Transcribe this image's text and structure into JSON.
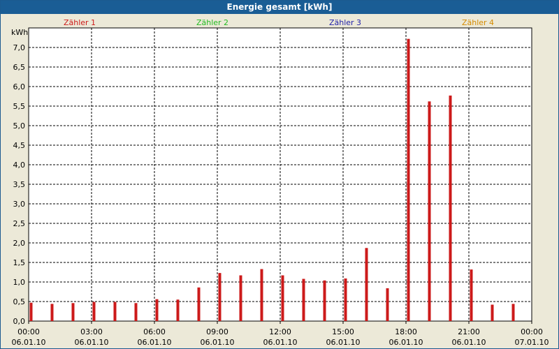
{
  "window": {
    "title": "Energie gesamt [kWh]"
  },
  "colors": {
    "bar": "#cc1a1a",
    "title_bg": "#1a5d95"
  },
  "chart_data": {
    "type": "bar",
    "title": "Energie gesamt [kWh]",
    "ylabel": "kWh",
    "ylim": [
      0,
      7.5
    ],
    "grid": true,
    "legend": [
      {
        "name": "Zähler 1",
        "color": "#cc1a1a"
      },
      {
        "name": "Zähler 2",
        "color": "#22bb22"
      },
      {
        "name": "Zähler 3",
        "color": "#2222aa"
      },
      {
        "name": "Zähler 4",
        "color": "#d48a00"
      }
    ],
    "y_ticks": [
      "0,0",
      "0,5",
      "1,0",
      "1,5",
      "2,0",
      "2,5",
      "3,0",
      "3,5",
      "4,0",
      "4,5",
      "5,0",
      "5,5",
      "6,0",
      "6,5",
      "7,0"
    ],
    "y_tick_values": [
      0,
      0.5,
      1,
      1.5,
      2,
      2.5,
      3,
      3.5,
      4,
      4.5,
      5,
      5.5,
      6,
      6.5,
      7
    ],
    "x_ticks": [
      {
        "time": "00:00",
        "date": "06.01.10",
        "hour": 0
      },
      {
        "time": "03:00",
        "date": "06.01.10",
        "hour": 3
      },
      {
        "time": "06:00",
        "date": "06.01.10",
        "hour": 6
      },
      {
        "time": "09:00",
        "date": "06.01.10",
        "hour": 9
      },
      {
        "time": "12:00",
        "date": "06.01.10",
        "hour": 12
      },
      {
        "time": "15:00",
        "date": "06.01.10",
        "hour": 15
      },
      {
        "time": "18:00",
        "date": "06.01.10",
        "hour": 18
      },
      {
        "time": "21:00",
        "date": "06.01.10",
        "hour": 21
      },
      {
        "time": "00:00",
        "date": "07.01.10",
        "hour": 24
      }
    ],
    "x_range_hours": [
      0,
      24
    ],
    "series": [
      {
        "name": "Zähler 1",
        "hours": [
          0,
          1,
          2,
          3,
          4,
          5,
          6,
          7,
          8,
          9,
          10,
          11,
          12,
          13,
          14,
          15,
          16,
          17,
          18,
          19,
          20,
          21,
          22,
          23
        ],
        "values": [
          0.47,
          0.44,
          0.46,
          0.49,
          0.49,
          0.46,
          0.56,
          0.55,
          0.86,
          1.23,
          1.17,
          1.33,
          1.17,
          1.08,
          1.04,
          1.09,
          1.87,
          0.84,
          7.22,
          5.62,
          5.77,
          1.32,
          0.42,
          0.44
        ]
      }
    ]
  }
}
